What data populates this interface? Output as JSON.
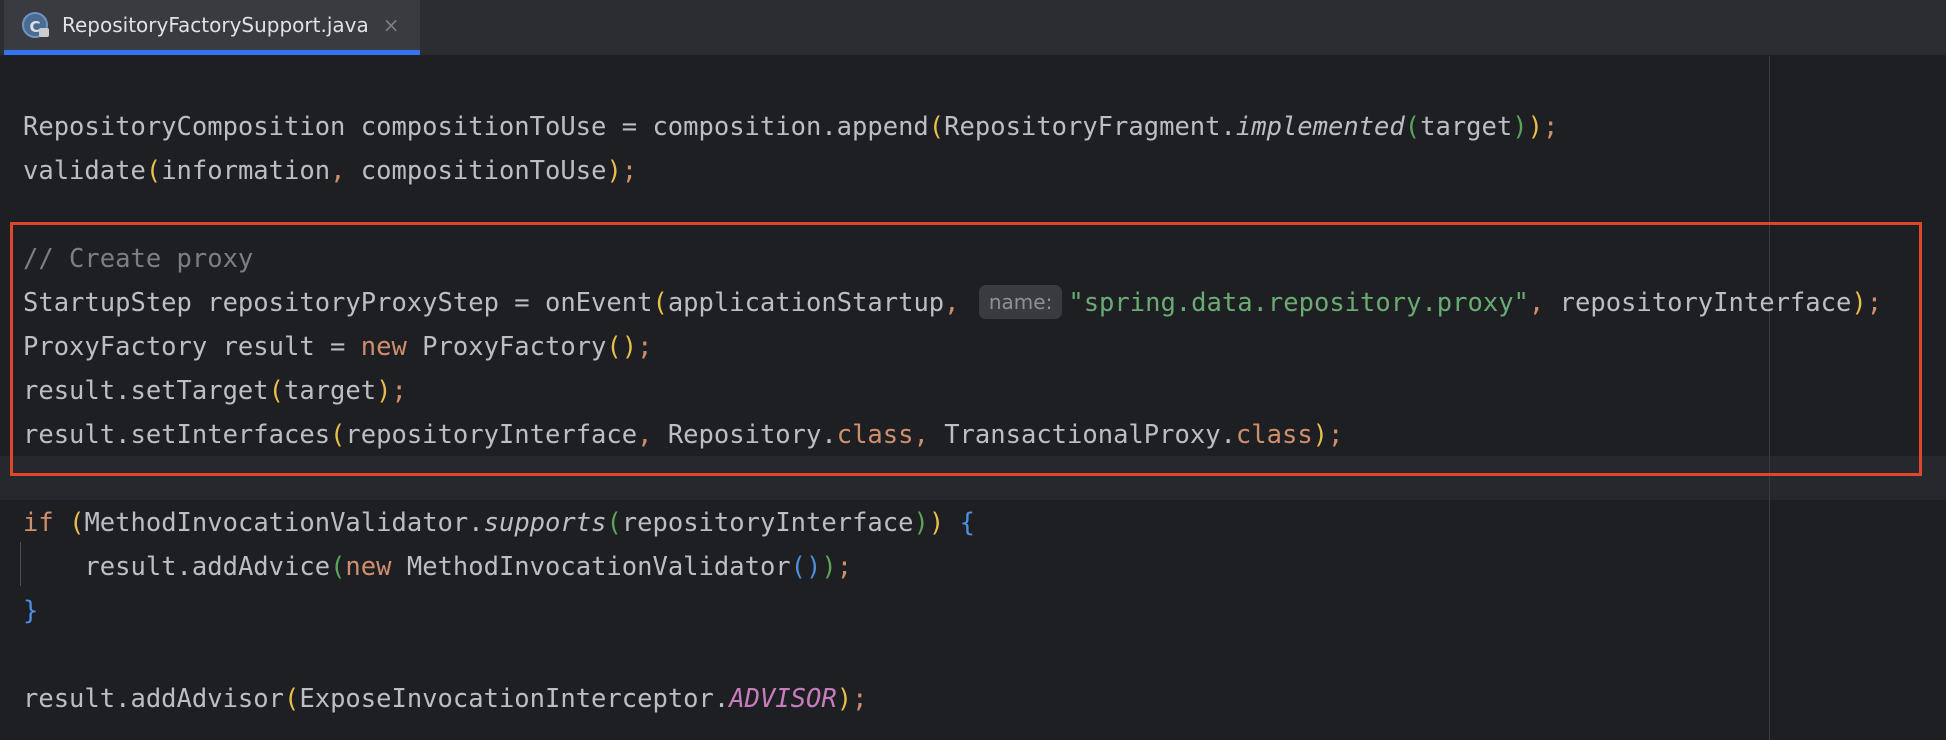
{
  "tab": {
    "title": "RepositoryFactorySupport.java",
    "icon": "java-class-icon",
    "icon_letter": "C",
    "close_glyph": "×"
  },
  "hint": {
    "label": "name:"
  },
  "code": {
    "line1": {
      "a": "RepositoryComposition compositionToUse = composition.append",
      "b": "RepositoryFragment.",
      "c": "implemented",
      "d": "target"
    },
    "line2": {
      "a": "validate",
      "b": "information",
      "c": "compositionToUse"
    },
    "comment": "// Create proxy",
    "line4": {
      "a": "StartupStep repositoryProxyStep = onEvent",
      "b": "applicationStartup",
      "c": "\"spring.data.repository.proxy\"",
      "d": "repositoryInterface"
    },
    "line5": {
      "a": "ProxyFactory result = ",
      "kw": "new",
      "b": " ProxyFactory"
    },
    "line6": {
      "a": "result.setTarget",
      "b": "target"
    },
    "line7": {
      "a": "result.setInterfaces",
      "b": "repositoryInterface",
      "c": "Repository.",
      "kw1": "class",
      "d": "TransactionalProxy.",
      "kw2": "class"
    },
    "line9": {
      "kw": "if",
      "a": "MethodInvocationValidator.",
      "b": "supports",
      "c": "repositoryInterface"
    },
    "line10": {
      "a": "result.addAdvice",
      "kw": "new",
      "b": " MethodInvocationValidator"
    },
    "line13": {
      "a": "result.addAdvisor",
      "b": "ExposeInvocationInterceptor.",
      "c": "ADVISOR"
    }
  },
  "colors": {
    "keyword": "#cf8e6d",
    "string": "#6aab73",
    "comment": "#7a7e85",
    "constant": "#c77dbb",
    "text": "#bcbec4",
    "highlight_box": "#e0462c",
    "tab_accent": "#3574f0"
  }
}
